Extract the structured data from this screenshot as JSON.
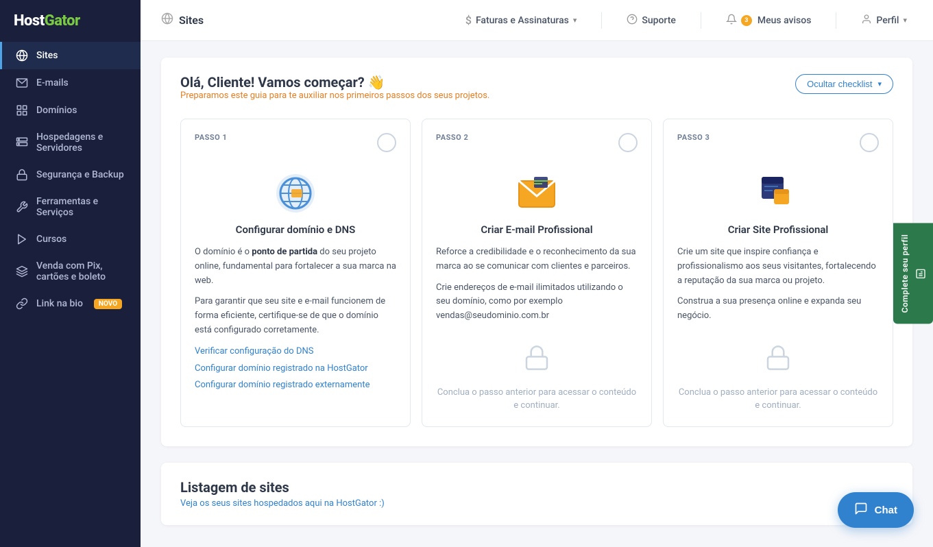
{
  "brand": {
    "name": "HostGator"
  },
  "sidebar": {
    "items": [
      {
        "id": "sites",
        "label": "Sites",
        "icon": "globe",
        "active": true
      },
      {
        "id": "emails",
        "label": "E-mails",
        "icon": "envelope"
      },
      {
        "id": "dominios",
        "label": "Domínios",
        "icon": "grid"
      },
      {
        "id": "hospedagens",
        "label": "Hospedagens e Servidores",
        "icon": "server"
      },
      {
        "id": "seguranca",
        "label": "Segurança e Backup",
        "icon": "lock"
      },
      {
        "id": "ferramentas",
        "label": "Ferramentas e Serviços",
        "icon": "tool"
      },
      {
        "id": "cursos",
        "label": "Cursos",
        "icon": "play"
      },
      {
        "id": "venda",
        "label": "Venda com Pix, cartões e boleto",
        "icon": "credit"
      },
      {
        "id": "linkbio",
        "label": "Link na bio",
        "icon": "link",
        "badge": "NOVO"
      }
    ]
  },
  "topbar": {
    "page_title": "Sites",
    "faturas_label": "Faturas e Assinaturas",
    "suporte_label": "Suporte",
    "avisos_label": "Meus avisos",
    "perfil_label": "Perfil",
    "notification_count": "3"
  },
  "welcome": {
    "title": "Olá, Cliente! Vamos começar? 👋",
    "subtitle": "Preparamos este guia para te auxiliar nos primeiros passos dos seus projetos.",
    "hide_btn": "Ocultar checklist"
  },
  "steps": [
    {
      "label": "PASSO 1",
      "title": "Configurar domínio e DNS",
      "body_p1_prefix": "O domínio é o ",
      "body_p1_bold": "ponto de partida",
      "body_p1_suffix": " do seu projeto online, fundamental para fortalecer a sua marca na web.",
      "body_p2": "Para garantir que seu site e e-mail funcionem de forma eficiente, certifique-se de que o domínio está configurado corretamente.",
      "links": [
        {
          "label": "Verificar configuração do DNS",
          "href": "#"
        },
        {
          "label": "Configurar domínio registrado na HostGator",
          "href": "#"
        },
        {
          "label": "Configurar domínio registrado externamente",
          "href": "#"
        }
      ]
    },
    {
      "label": "PASSO 2",
      "title": "Criar E-mail Profissional",
      "body_p1": "Reforce a credibilidade e o reconhecimento da sua marca ao se comunicar com clientes e parceiros.",
      "body_p2": "Crie endereços de e-mail ilimitados utilizando o seu domínio, como por exemplo vendas@seudominio.com.br",
      "lock_text": "Conclua o passo anterior para acessar o conteúdo e continuar."
    },
    {
      "label": "PASSO 3",
      "title": "Criar Site Profissional",
      "body_p1": "Crie um site que inspire confiança e profissionalismo aos seus visitantes, fortalecendo a reputação da sua marca ou projeto.",
      "body_p2": "Construa a sua presença online e expanda seu negócio.",
      "lock_text": "Conclua o passo anterior para acessar o conteúdo e continuar."
    }
  ],
  "listagem": {
    "title": "Listagem de sites",
    "subtitle_prefix": "Veja os seus sites hospedados aqui na ",
    "subtitle_brand": "HostGator",
    "subtitle_suffix": " :)"
  },
  "chat": {
    "label": "Chat"
  },
  "right_tab": {
    "label": "Complete seu perfil"
  }
}
